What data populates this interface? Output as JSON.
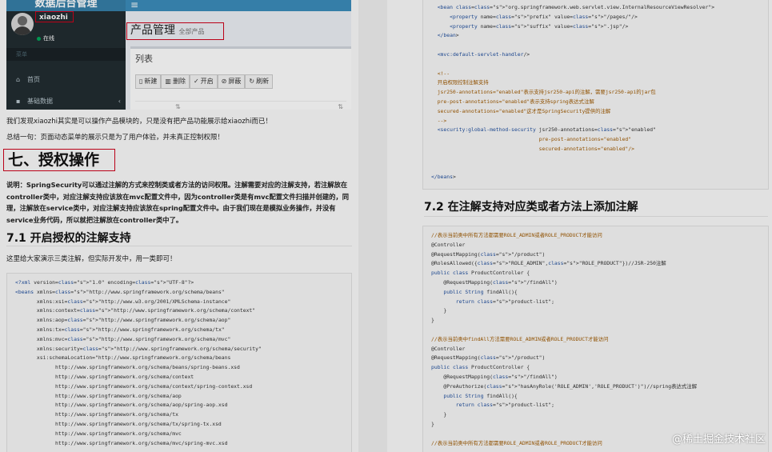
{
  "admin": {
    "brand": "数据后台管理",
    "menu_icon": "≡",
    "username": "xiaozhi",
    "status": "在线",
    "sidebar_header": "菜单",
    "sidebar_items": [
      {
        "label": "首页",
        "icon": "home-icon"
      },
      {
        "label": "基础数据",
        "icon": "folder-icon"
      }
    ],
    "page_title": "产品管理",
    "page_subtitle": "全部产品",
    "box_title": "列表",
    "toolbar": [
      "新建",
      "删除",
      "开启",
      "屏蔽",
      "刷新"
    ],
    "colors": {
      "sidebar": "#222d32",
      "topbar": "#3c8dbc",
      "highlight": "#d0021b"
    }
  },
  "left": {
    "para1": "我们发现xiaozhi其实是可以操作产品模块的，只是没有把产品功能展示给xiaozhi而已！",
    "para2": "总结一句：页面动态菜单的展示只是为了用户体验，并未真正控制权限！",
    "heading": "七、授权操作",
    "note": "说明：SpringSecurity可以通过注解的方式来控制类或者方法的访问权限。注解需要对应的注解支持，若注解放在controller类中，对应注解支持应该放在mvc配置文件中，因为controller类是有mvc配置文件扫描并创建的，同理，注解放在service类中，对应注解支持应该放在spring配置文件中。由于我们现在是模拟业务操作，并没有service业务代码，所以就把注解放在controller类中了。",
    "subheading": "7.1 开启授权的注解支持",
    "para3": "这里给大家演示三类注解，但实际开发中，用一类即可！",
    "code": [
      "<?xml version=\"1.0\" encoding=\"UTF-8\"?>",
      "<beans xmlns=\"http://www.springframework.org/schema/beans\"",
      "       xmlns:xsi=\"http://www.w3.org/2001/XMLSchema-instance\"",
      "       xmlns:context=\"http://www.springframework.org/schema/context\"",
      "       xmlns:aop=\"http://www.springframework.org/schema/aop\"",
      "       xmlns:tx=\"http://www.springframework.org/schema/tx\"",
      "       xmlns:mvc=\"http://www.springframework.org/schema/mvc\"",
      "       xmlns:security=\"http://www.springframework.org/schema/security\"",
      "       xsi:schemaLocation=\"http://www.springframework.org/schema/beans",
      "             http://www.springframework.org/schema/beans/spring-beans.xsd",
      "             http://www.springframework.org/schema/context",
      "             http://www.springframework.org/schema/context/spring-context.xsd",
      "             http://www.springframework.org/schema/aop",
      "             http://www.springframework.org/schema/aop/spring-aop.xsd",
      "             http://www.springframework.org/schema/tx",
      "             http://www.springframework.org/schema/tx/spring-tx.xsd",
      "             http://www.springframework.org/schema/mvc",
      "             http://www.springframework.org/schema/mvc/spring-mvc.xsd"
    ]
  },
  "right": {
    "code1": [
      "  <bean class=\"org.springframework.web.servlet.view.InternalResourceViewResolver\">",
      "      <property name=\"prefix\" value=\"/pages/\"/>",
      "      <property name=\"suffix\" value=\".jsp\"/>",
      "  </bean>",
      "",
      "  <mvc:default-servlet-handler/>",
      "",
      "  <!--",
      "  开启权限控制注解支持",
      "  jsr250-annotations=\"enabled\"表示支持jsr250-api的注解，需要jsr250-api的jar包",
      "  pre-post-annotations=\"enabled\"表示支持spring表达式注解",
      "  secured-annotations=\"enabled\"这才是SpringSecurity提供的注解",
      "  -->",
      "  <security:global-method-security jsr250-annotations=\"enabled\"",
      "                                   pre-post-annotations=\"enabled\"",
      "                                   secured-annotations=\"enabled\"/>",
      "",
      "",
      "</beans>"
    ],
    "heading": "7.2 在注解支持对应类或者方法上添加注解",
    "code2": [
      "//表示当前类中所有方法都需要ROLE_ADMIN或者ROLE_PRODUCT才能访问",
      "@Controller",
      "@RequestMapping(\"/product\")",
      "@RolesAllowed({\"ROLE_ADMIN\",\"ROLE_PRODUCT\"})//JSR-250注解",
      "public class ProductController {",
      "    @RequestMapping(\"/findAll\")",
      "    public String findAll(){",
      "        return \"product-list\";",
      "    }",
      "}",
      "",
      "//表示当前类中findAll方法需要ROLE_ADMIN或者ROLE_PRODUCT才能访问",
      "@Controller",
      "@RequestMapping(\"/product\")",
      "public class ProductController {",
      "    @RequestMapping(\"/findAll\")",
      "    @PreAuthorize(\"hasAnyRole('ROLE_ADMIN','ROLE_PRODUCT')\")//spring表达式注解",
      "    public String findAll(){",
      "        return \"product-list\";",
      "    }",
      "}",
      "",
      "//表示当前类中所有方法都需要ROLE_ADMIN或者ROLE_PRODUCT才能访问"
    ]
  },
  "watermark": "@稀土掘金技术社区"
}
